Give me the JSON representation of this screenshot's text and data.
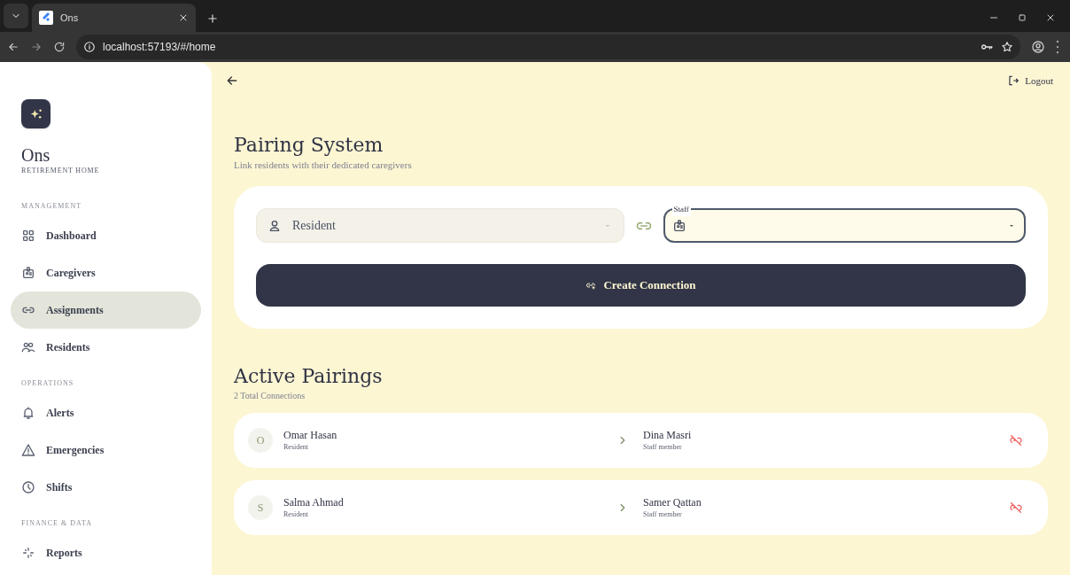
{
  "browser": {
    "tab_title": "Ons",
    "url": "localhost:57193/#/home"
  },
  "sidebar": {
    "brand": "Ons",
    "tagline": "RETIREMENT HOME",
    "sections": [
      {
        "label": "MANAGEMENT",
        "items": [
          {
            "label": "Dashboard",
            "selected": false
          },
          {
            "label": "Caregivers",
            "selected": false
          },
          {
            "label": "Assignments",
            "selected": true
          },
          {
            "label": "Residents",
            "selected": false
          }
        ]
      },
      {
        "label": "OPERATIONS",
        "items": [
          {
            "label": "Alerts",
            "selected": false
          },
          {
            "label": "Emergencies",
            "selected": false
          },
          {
            "label": "Shifts",
            "selected": false
          }
        ]
      },
      {
        "label": "FINANCE & DATA",
        "items": [
          {
            "label": "Reports",
            "selected": false
          }
        ]
      }
    ]
  },
  "header": {
    "logout": "Logout"
  },
  "pairing": {
    "title": "Pairing System",
    "subtitle": "Link residents with their dedicated caregivers",
    "resident_field": {
      "placeholder": "Resident"
    },
    "staff_field": {
      "label": "Staff"
    },
    "create_button": "Create Connection"
  },
  "active": {
    "title": "Active Pairings",
    "count": "2 Total Connections",
    "rows": [
      {
        "initial": "O",
        "resident": "Omar Hasan",
        "resident_role": "Resident",
        "staff": "Dina Masri",
        "staff_role": "Staff member"
      },
      {
        "initial": "S",
        "resident": "Salma Ahmad",
        "resident_role": "Resident",
        "staff": "Samer Qattan",
        "staff_role": "Staff member"
      }
    ]
  }
}
